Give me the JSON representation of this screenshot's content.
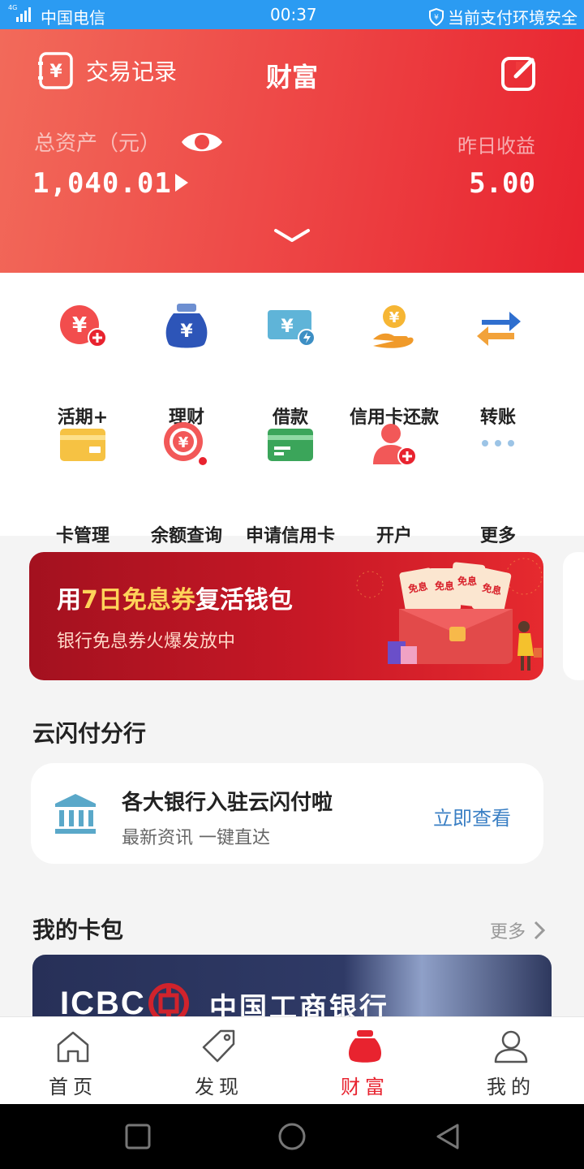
{
  "status_bar": {
    "network": "4G",
    "carrier": "中国电信",
    "time": "00:37",
    "security": "当前支付环境安全"
  },
  "header": {
    "transactions_label": "交易记录",
    "title": "财富",
    "total_assets_label": "总资产（元）",
    "total_assets_value": "1,040.01",
    "yesterday_label": "昨日收益",
    "yesterday_value": "5.00"
  },
  "quick_actions": [
    {
      "label": "活期+",
      "icon": "current-plus-icon"
    },
    {
      "label": "理财",
      "icon": "money-bag-icon"
    },
    {
      "label": "借款",
      "icon": "loan-icon"
    },
    {
      "label": "信用卡还款",
      "icon": "card-repay-icon"
    },
    {
      "label": "转账",
      "icon": "transfer-icon"
    },
    {
      "label": "卡管理",
      "icon": "card-manage-icon"
    },
    {
      "label": "余额查询",
      "icon": "balance-query-icon"
    },
    {
      "label": "申请信用卡",
      "icon": "apply-card-icon"
    },
    {
      "label": "开户",
      "icon": "open-account-icon"
    },
    {
      "label": "更多",
      "icon": "more-dots-icon"
    }
  ],
  "banner": {
    "title_prefix": "用",
    "title_highlight": "7日免息券",
    "title_suffix": "复活钱包",
    "subtitle": "银行免息券火爆发放中",
    "coupon_text": "免息"
  },
  "branch_section": {
    "title": "云闪付分行",
    "headline": "各大银行入驻云闪付啦",
    "subline": "最新资讯 一键直达",
    "link": "立即查看"
  },
  "card_wallet": {
    "title": "我的卡包",
    "more": "更多",
    "card_brand": "ICBC",
    "card_bank": "中国工商银行"
  },
  "tabs": [
    {
      "label": "首页",
      "icon": "home-icon",
      "active": false
    },
    {
      "label": "发现",
      "icon": "tag-icon",
      "active": false
    },
    {
      "label": "财富",
      "icon": "wealth-bag-icon",
      "active": true
    },
    {
      "label": "我的",
      "icon": "user-icon",
      "active": false
    }
  ],
  "colors": {
    "brand_red": "#e8232f",
    "link_blue": "#3a7fc4",
    "status_bar": "#2b9bf2"
  }
}
